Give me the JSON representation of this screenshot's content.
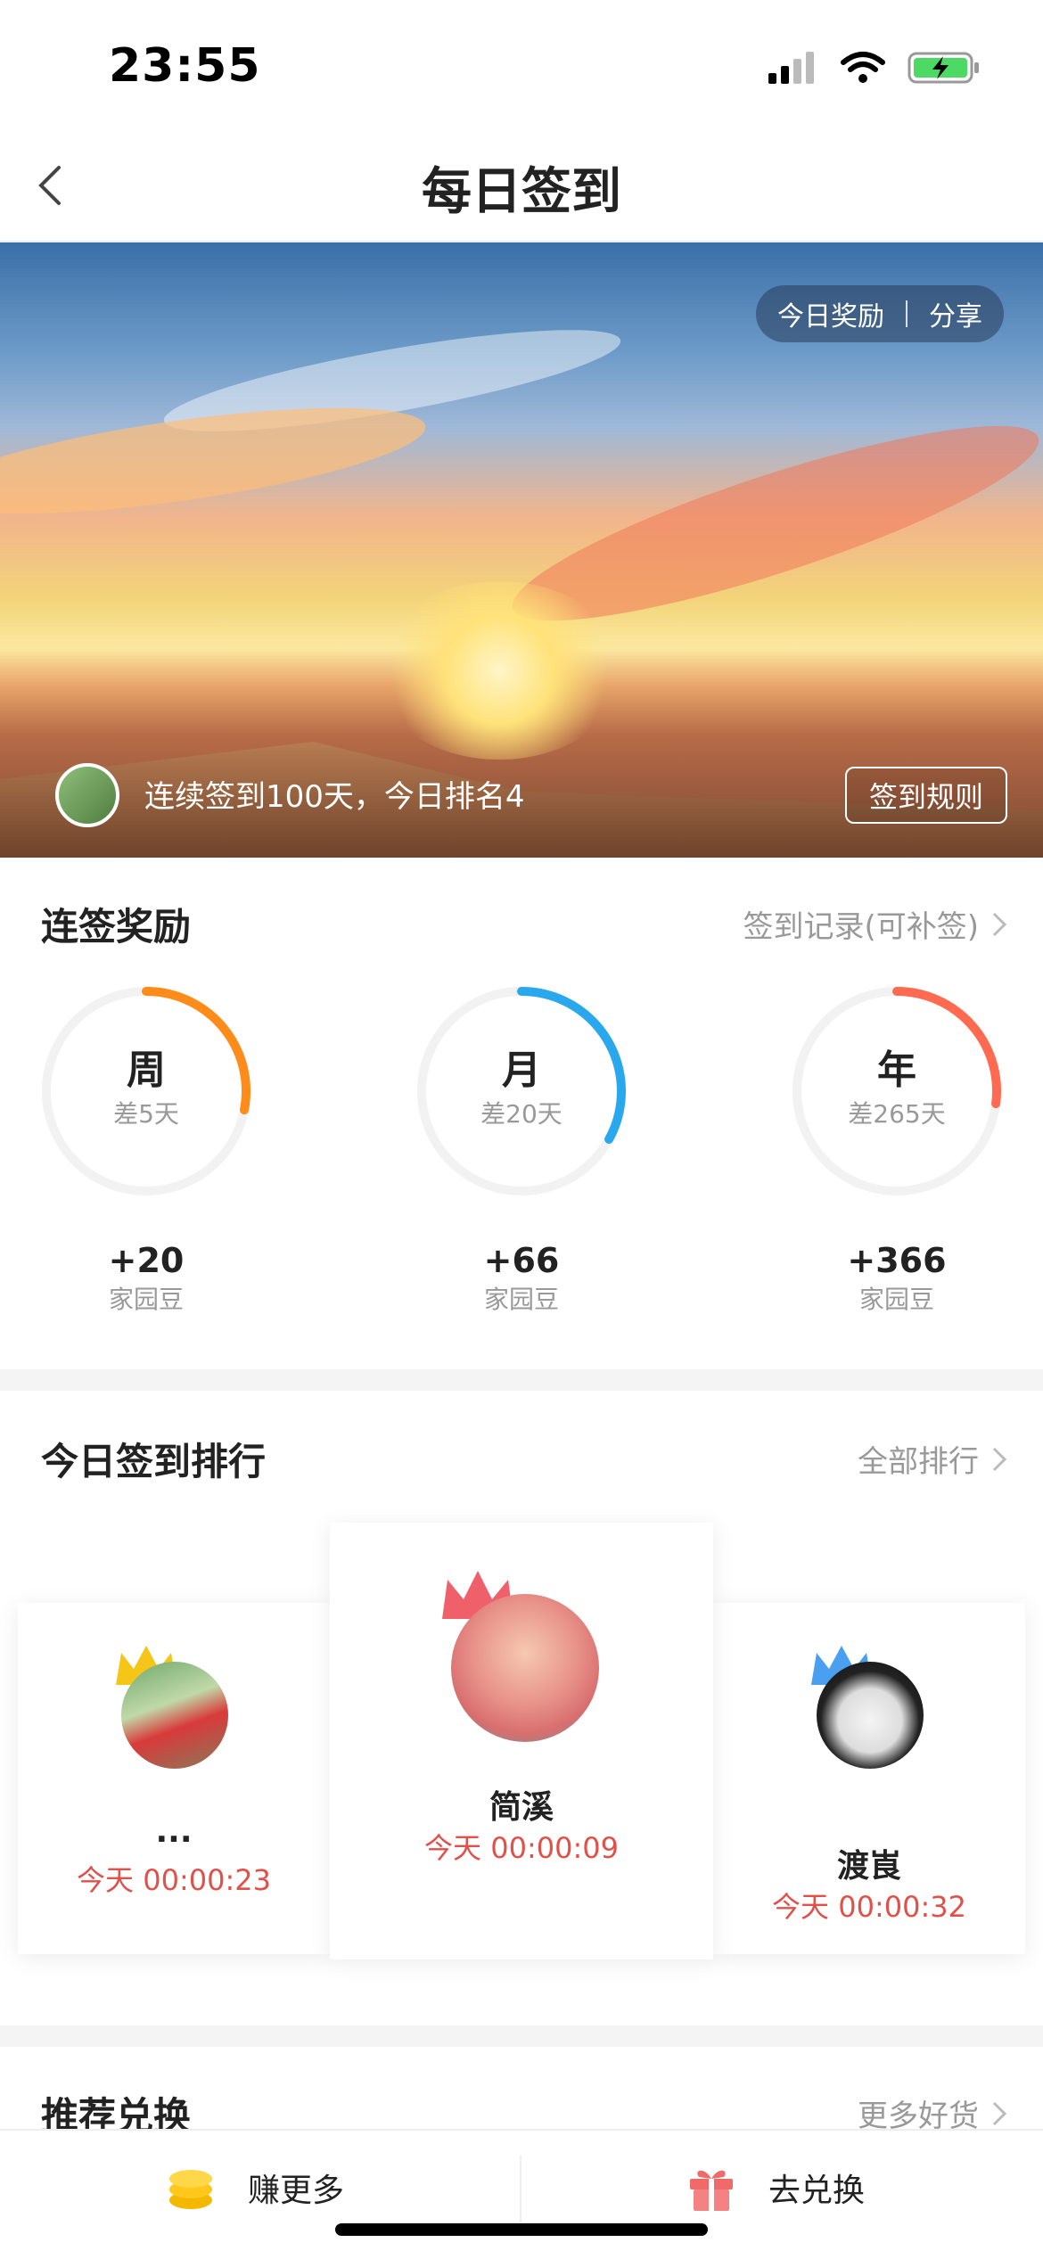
{
  "status_bar": {
    "time": "23:55"
  },
  "nav": {
    "title": "每日签到"
  },
  "banner": {
    "pill_reward": "今日奖励",
    "pill_share": "分享",
    "streak_text": "连续签到100天，今日排名4",
    "rules_button": "签到规则"
  },
  "streak_rewards": {
    "title": "连签奖励",
    "link": "签到记录(可补签)",
    "items": [
      {
        "label": "周",
        "remaining": "差5天",
        "points": "+20",
        "unit": "家园豆",
        "progress": 0.28,
        "color": "#ff8c1a"
      },
      {
        "label": "月",
        "remaining": "差20天",
        "points": "+66",
        "unit": "家园豆",
        "progress": 0.33,
        "color": "#2aa8ee"
      },
      {
        "label": "年",
        "remaining": "差265天",
        "points": "+366",
        "unit": "家园豆",
        "progress": 0.27,
        "color": "#ff6a50"
      }
    ]
  },
  "ranking": {
    "title": "今日签到排行",
    "link": "全部排行",
    "entries": [
      {
        "name": "...",
        "time": "今天 00:00:23",
        "crown_color": "#f5c518"
      },
      {
        "name": "简溪",
        "time": "今天 00:00:09",
        "crown_color": "#f0606a"
      },
      {
        "name": "渡崀",
        "time": "今天 00:00:32",
        "crown_color": "#4a9ff0"
      }
    ]
  },
  "recommend": {
    "title": "推荐兑换",
    "link": "更多好货"
  },
  "bottom_bar": {
    "earn_more": "赚更多",
    "redeem": "去兑换"
  }
}
